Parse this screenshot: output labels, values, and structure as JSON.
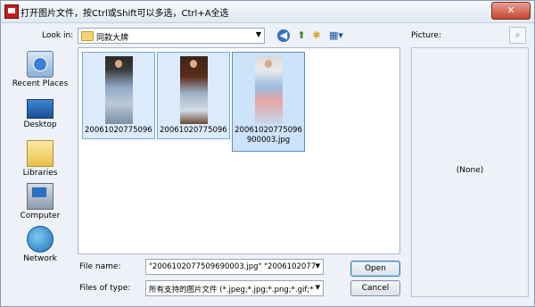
{
  "window": {
    "title": "打开图片文件，按Ctrl或Shift可以多选，Ctrl+A全选",
    "close_label": "✕"
  },
  "toolbar": {
    "look_in_label": "Look in:",
    "look_in_value": "同款大牌",
    "icons": [
      "back-icon",
      "up-folder-icon",
      "new-folder-icon",
      "view-menu-icon"
    ]
  },
  "places": [
    {
      "label": "Recent Places",
      "icon": "recent-places-icon"
    },
    {
      "label": "Desktop",
      "icon": "desktop-icon"
    },
    {
      "label": "Libraries",
      "icon": "libraries-icon"
    },
    {
      "label": "Computer",
      "icon": "computer-icon"
    },
    {
      "label": "Network",
      "icon": "network-icon"
    }
  ],
  "files": [
    {
      "caption": "20061020775096...",
      "selected": false
    },
    {
      "caption": "20061020775096...",
      "selected": false
    },
    {
      "caption": "20061020775096900003.jpg",
      "selected": true
    }
  ],
  "preview": {
    "label": "Picture:",
    "empty_text": "(None)"
  },
  "form": {
    "file_name_label": "File name:",
    "file_name_value": "\"2006102077509690003.jpg\" \"20061020775",
    "file_type_label": "Files of type:",
    "file_type_value": "所有支持的图片文件 (*.jpeg;*.jpg;*.png;*.gif;*",
    "open_label": "Open",
    "cancel_label": "Cancel"
  },
  "colors": {
    "selection": "#cde3fa",
    "accent": "#3c7fb1",
    "window_bg": "#eef2f8"
  }
}
